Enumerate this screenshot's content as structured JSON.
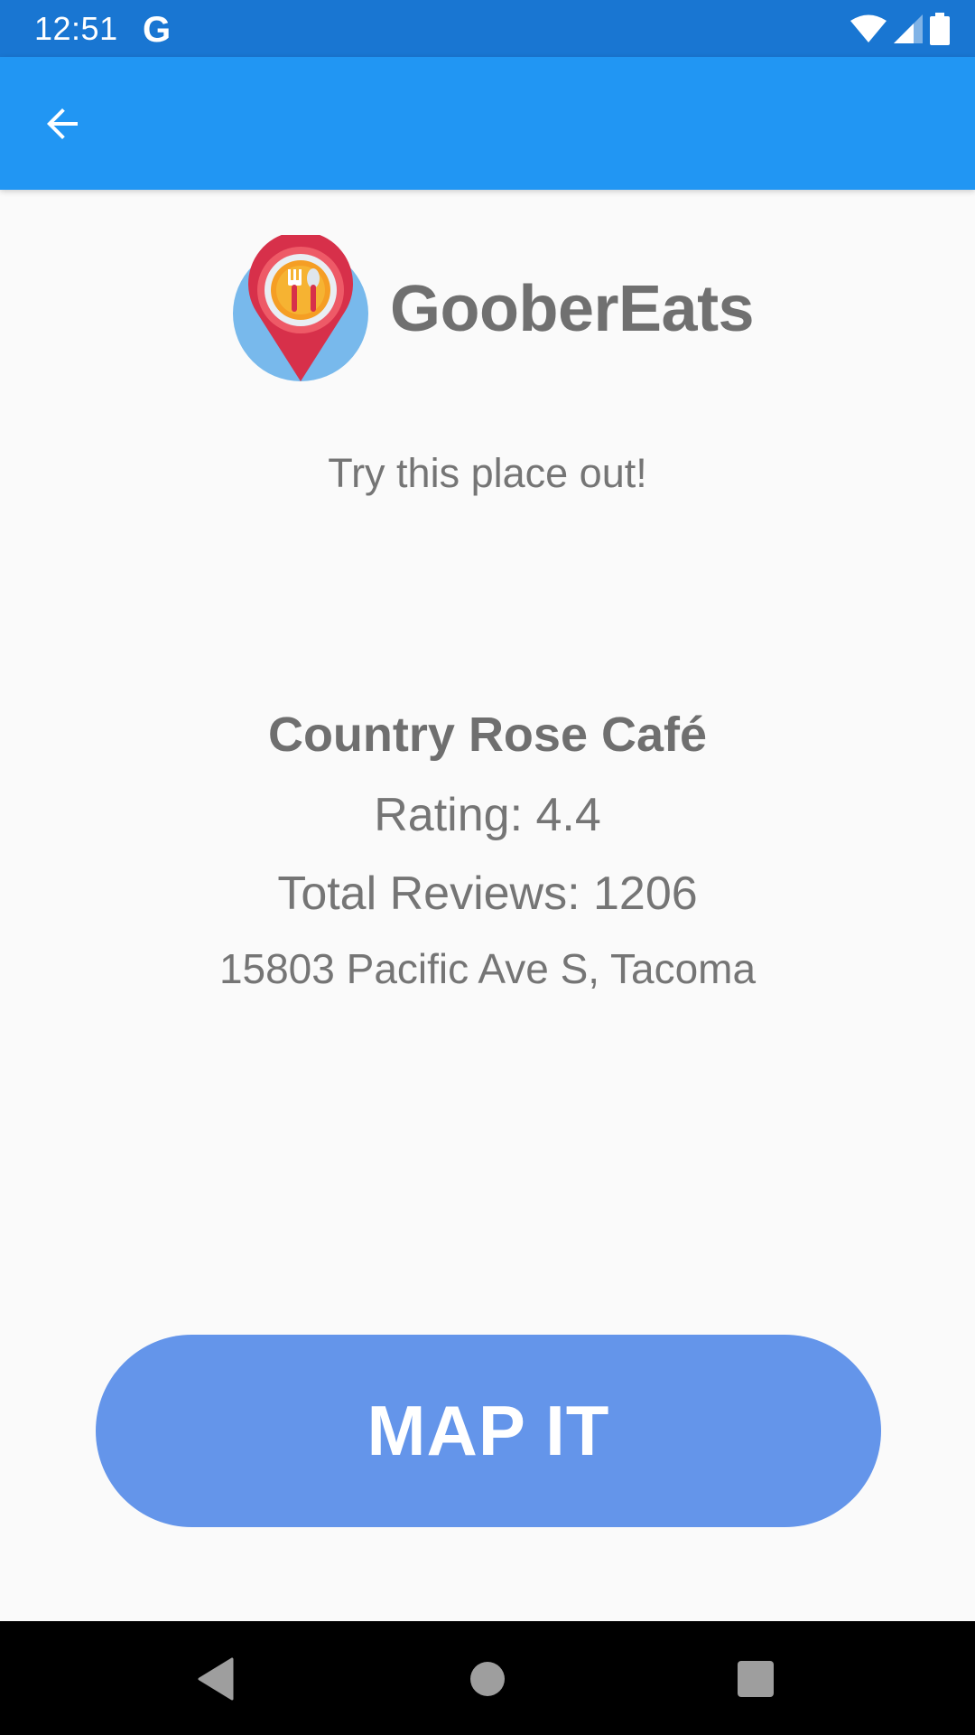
{
  "status_bar": {
    "time": "12:51",
    "g_label": "G",
    "icons": [
      "wifi-icon",
      "cell-signal-icon",
      "battery-icon"
    ]
  },
  "app_bar": {
    "back_icon": "arrow-back-icon",
    "color": "#2196f3"
  },
  "brand": {
    "name": "GooberEats",
    "logo_icon": "restaurant-pin-logo"
  },
  "content": {
    "tagline": "Try this place out!",
    "place_name": "Country Rose Café",
    "rating": "Rating: 4.4",
    "reviews": "Total Reviews: 1206",
    "address": "15803 Pacific Ave S, Tacoma"
  },
  "actions": {
    "map_label": "MAP IT",
    "map_color": "#6495ea"
  },
  "nav_bar": {
    "icons": [
      "nav-back-icon",
      "nav-home-icon",
      "nav-recents-icon"
    ]
  }
}
